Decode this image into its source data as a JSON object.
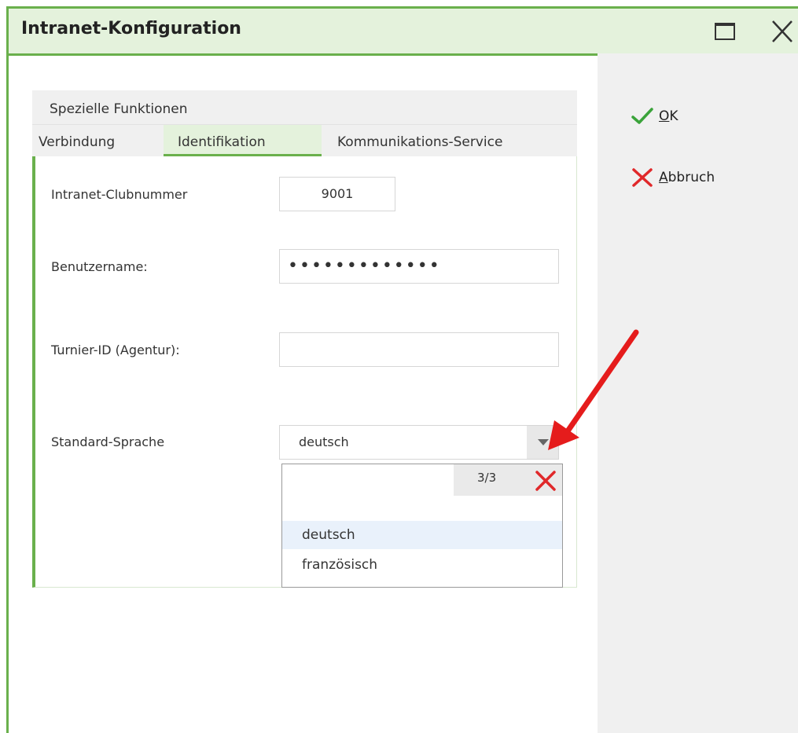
{
  "window": {
    "title": "Intranet-Konfiguration"
  },
  "actions": {
    "ok_label_u": "O",
    "ok_label_rest": "K",
    "cancel_label_u": "A",
    "cancel_label_rest": "bbruch"
  },
  "tabs": {
    "row1": [
      {
        "label": "Spezielle Funktionen"
      }
    ],
    "row2": [
      {
        "label": "Verbindung"
      },
      {
        "label": "Identifikation",
        "active": true
      },
      {
        "label": "Kommunikations-Service"
      }
    ]
  },
  "form": {
    "club_label": "Intranet-Clubnummer",
    "club_value": "9001",
    "user_label": "Benutzername:",
    "user_value": "•••••••••••••",
    "turnier_label": "Turnier-ID (Agentur):",
    "turnier_value": "",
    "lang_label": "Standard-Sprache",
    "lang_value": "deutsch"
  },
  "dropdown": {
    "count": "3/3",
    "options": [
      "deutsch",
      "französisch"
    ]
  },
  "colors": {
    "accent": "#6ab04c",
    "tint": "#e4f2dc",
    "ok": "#3aa33a",
    "cancel": "#e0282a",
    "arrow": "#e51c1c"
  },
  "icons": [
    "window-maximize-icon",
    "window-close-icon",
    "checkmark-icon",
    "cross-icon",
    "dropdown-arrow-icon",
    "clear-icon",
    "red-arrow-annotation"
  ]
}
